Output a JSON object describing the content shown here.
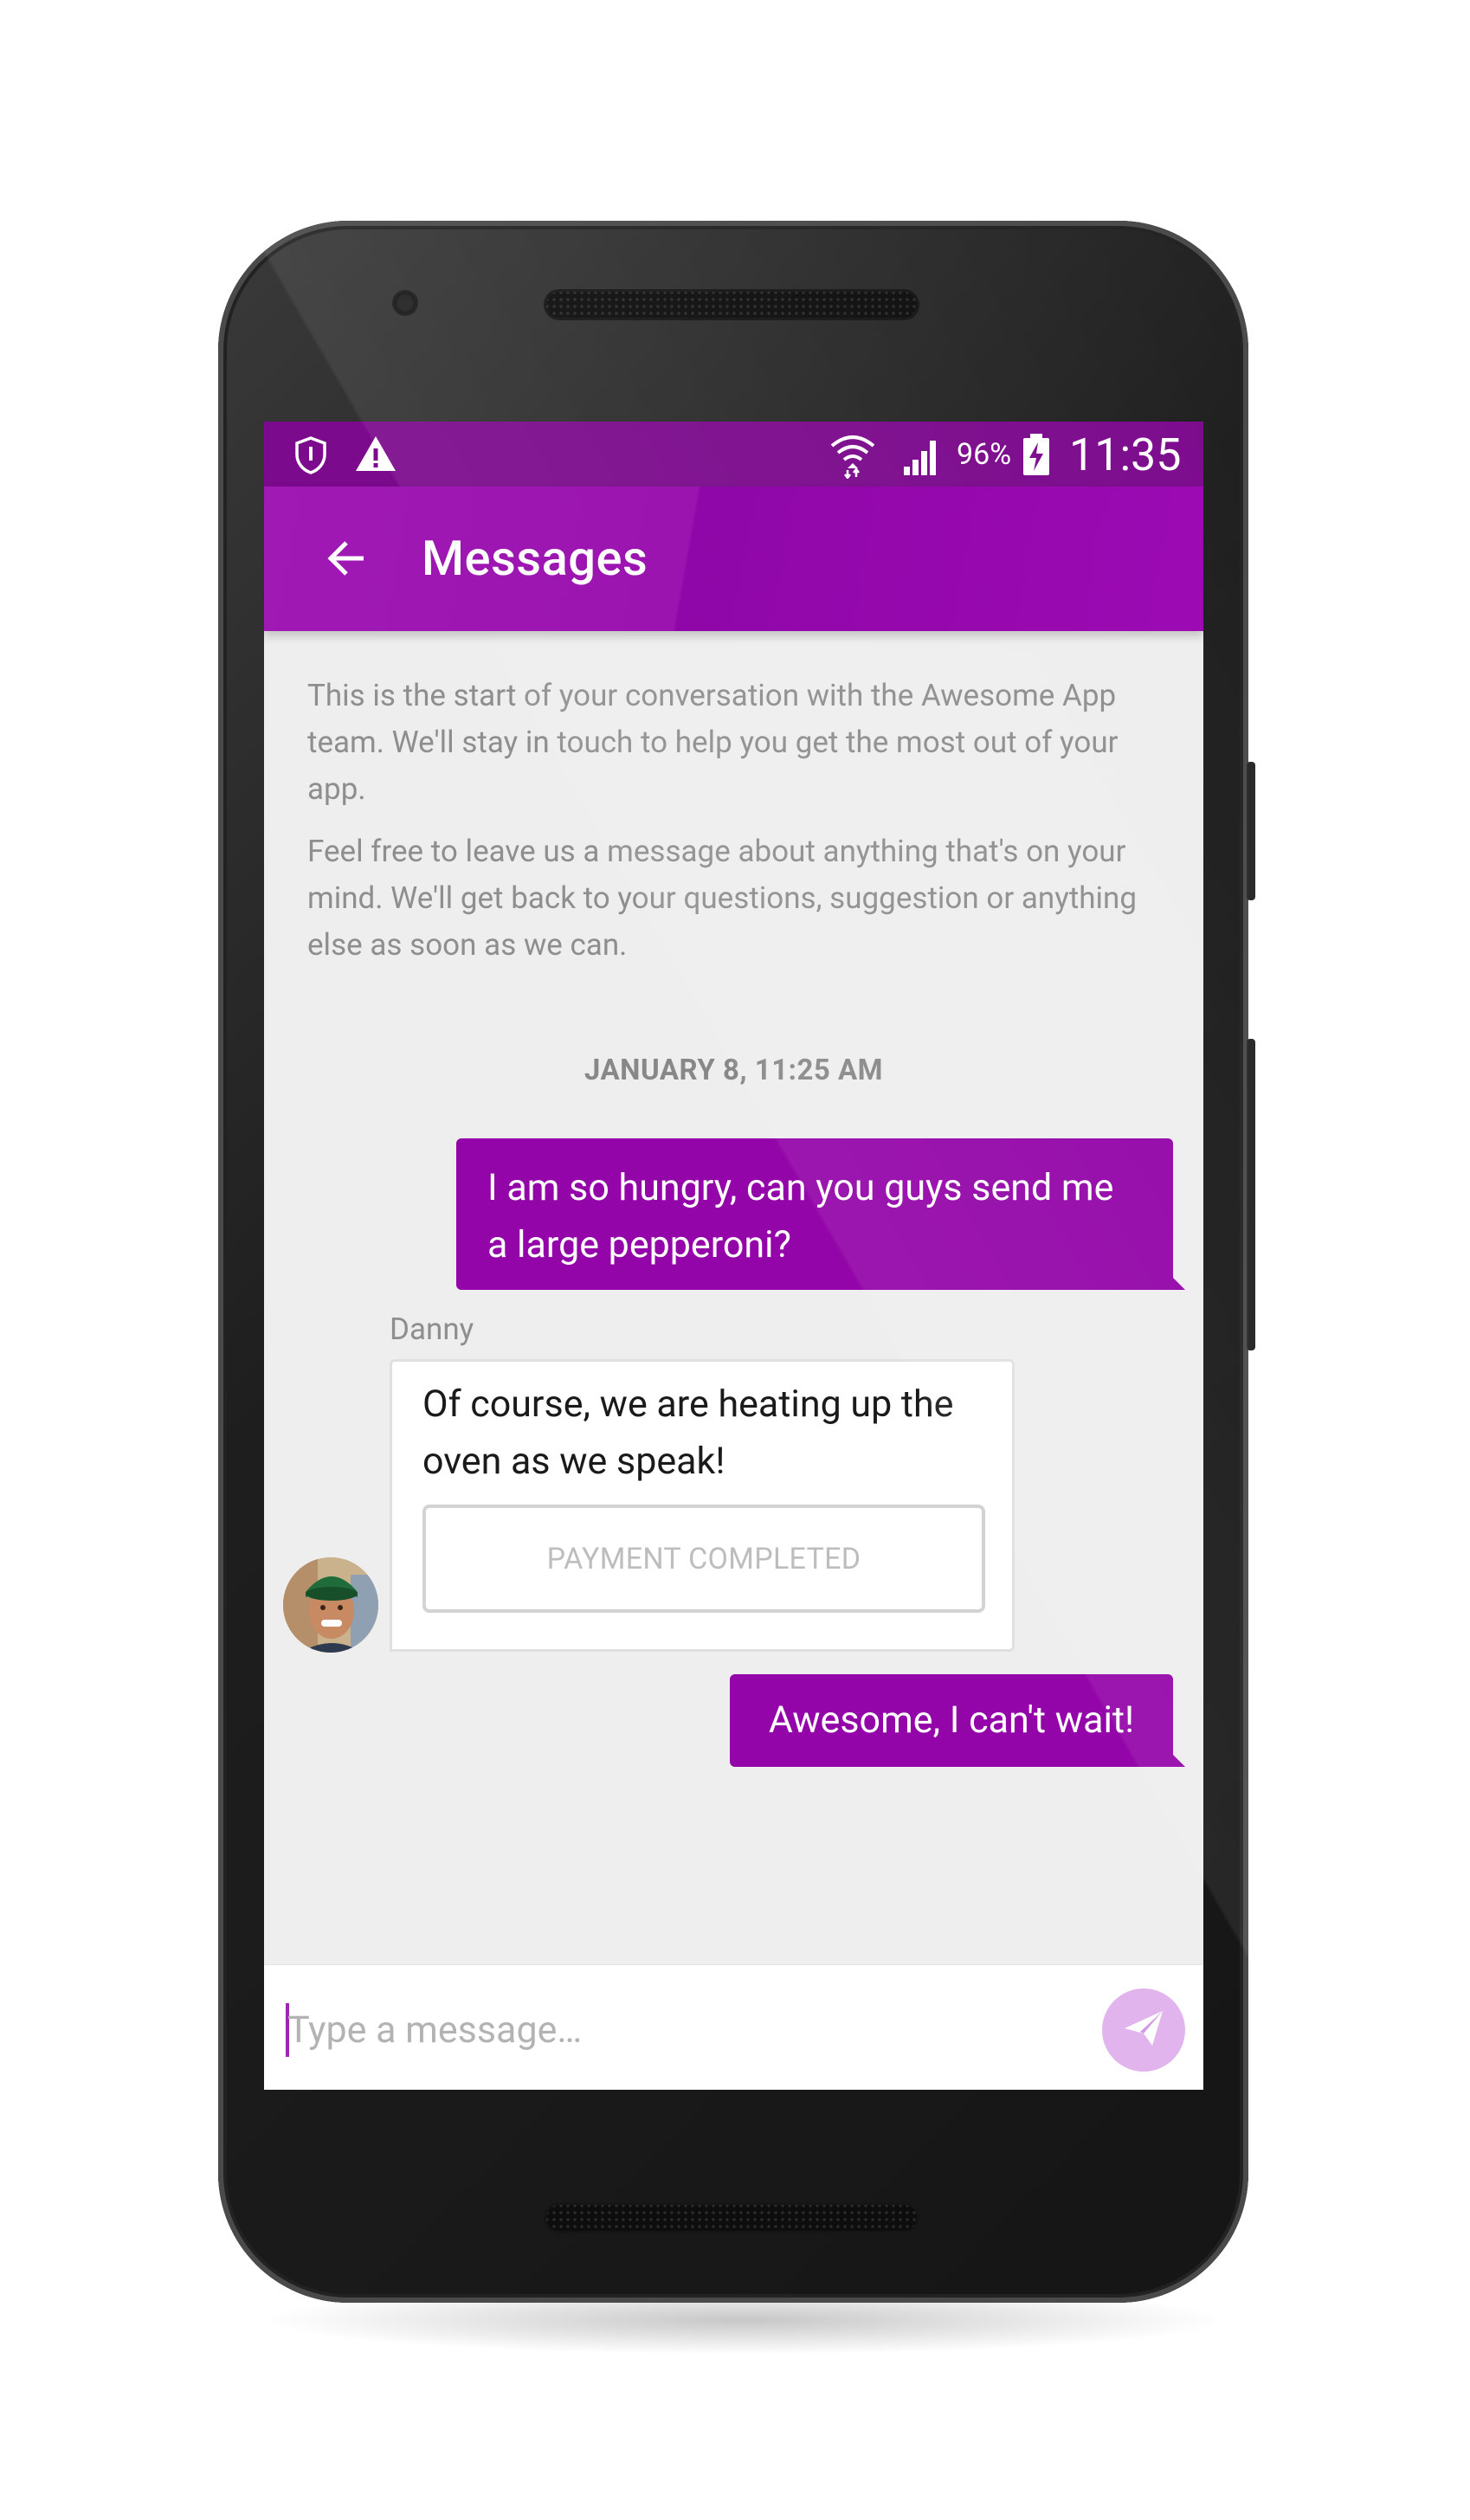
{
  "status_bar": {
    "battery_percent": "96%",
    "time": "11:35",
    "left_icons": [
      "shield-icon",
      "warning-icon"
    ],
    "right_icons": [
      "wifi-icon",
      "signal-icon",
      "battery-charging-icon"
    ]
  },
  "app_bar": {
    "back_icon": "arrow-back-icon",
    "title": "Messages"
  },
  "intro": {
    "paragraph_1": "This is the start of your conversation with the Awesome App team. We'll stay in touch to help you get the most out of your app.",
    "paragraph_2": "Feel free to leave us a message about anything that's on your mind. We'll get back to your questions, suggestion or anything else as soon as we can."
  },
  "conversation": {
    "timestamp": "JANUARY 8, 11:25 AM",
    "messages": [
      {
        "direction": "outgoing",
        "text": "I am so hungry, can you guys send me a large pepperoni?"
      },
      {
        "direction": "incoming",
        "sender": "Danny",
        "text": "Of course, we are heating up the oven as we speak!",
        "action_label": "PAYMENT COMPLETED"
      },
      {
        "direction": "outgoing",
        "text": "Awesome, I can't wait!"
      }
    ]
  },
  "composer": {
    "placeholder": "Type a message…",
    "value": "",
    "send_icon": "send-icon"
  },
  "colors": {
    "status_bar": "#7b0a8c",
    "app_bar": "#9c0ab3",
    "outgoing_bubble": "#9305a8",
    "send_button": "#e2b4ee",
    "background": "#eeeeee"
  }
}
